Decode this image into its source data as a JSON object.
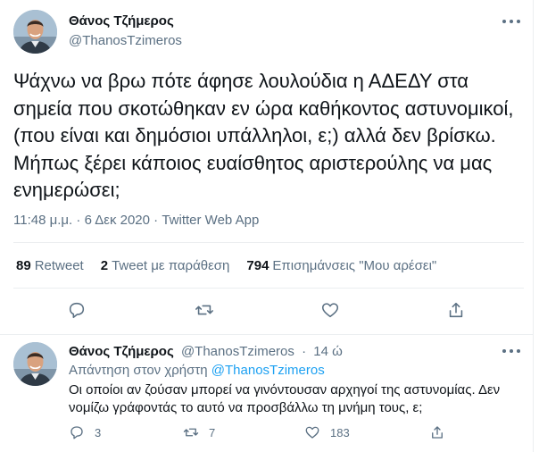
{
  "tweet": {
    "author_name": "Θάνος Τζήμερος",
    "author_handle": "@ThanosTzimeros",
    "text": "Ψάχνω να βρω πότε άφησε λουλούδια η ΑΔΕΔΥ στα σημεία που σκοτώθηκαν εν ώρα καθήκοντος αστυνομικοί, (που είναι και δημόσιοι υπάλληλοι, ε;) αλλά δεν βρίσκω. Μήπως ξέρει κάποιος ευαίσθητος αριστερούλης να μας ενημερώσει;",
    "time": "11:48 μ.μ.",
    "date": "6 Δεκ 2020",
    "source": "Twitter Web App",
    "separator": "·",
    "stats": {
      "retweets_count": "89",
      "retweets_label": "Retweet",
      "quotes_count": "2",
      "quotes_label": "Tweet με παράθεση",
      "likes_count": "794",
      "likes_label": "Επισημάνσεις \"Μου αρέσει\""
    }
  },
  "reply": {
    "author_name": "Θάνος Τζήμερος",
    "author_handle": "@ThanosTzimeros",
    "separator": "·",
    "time": "14 ώ",
    "replying_prefix": "Απάντηση στον χρήστη",
    "replying_to": "@ThanosTzimeros",
    "text": "Οι οποίοι αν ζούσαν μπορεί να γινόντουσαν αρχηγοί της αστυνομίας. Δεν νομίζω γράφοντάς το αυτό να προσβάλλω τη μνήμη τους, ε;",
    "reply_count": "3",
    "retweet_count": "7",
    "like_count": "183"
  },
  "icons": {
    "reply": "speech-bubble-icon",
    "retweet": "retweet-arrows-icon",
    "like": "heart-outline-icon",
    "share": "share-upload-icon",
    "more": "more-dots-icon"
  },
  "colors": {
    "text_primary": "#0f1419",
    "text_secondary": "#5b7083",
    "link": "#1da1f2",
    "divider": "#ebeef0"
  }
}
